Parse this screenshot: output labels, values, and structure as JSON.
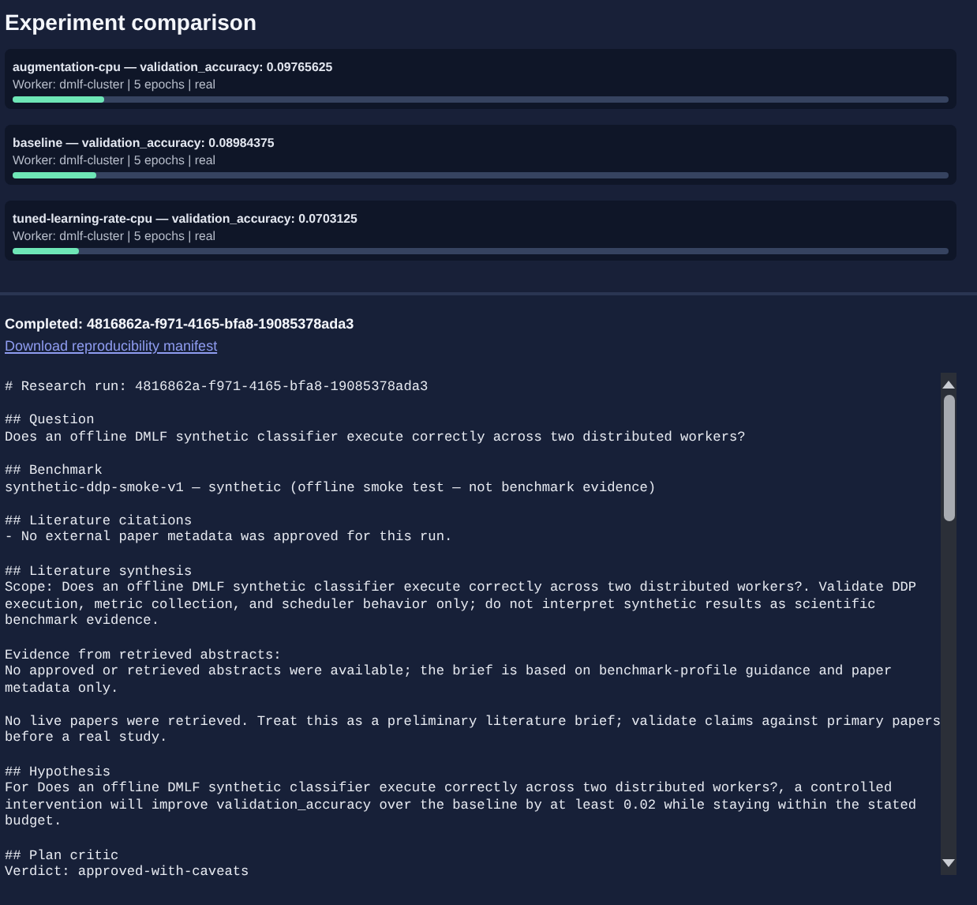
{
  "title": "Experiment comparison",
  "experiments": [
    {
      "heading": "augmentation-cpu — validation_accuracy: 0.09765625",
      "meta": "Worker: dmlf-cluster | 5 epochs | real",
      "level": 0.098
    },
    {
      "heading": "baseline — validation_accuracy: 0.08984375",
      "meta": "Worker: dmlf-cluster | 5 epochs | real",
      "level": 0.09
    },
    {
      "heading": "tuned-learning-rate-cpu — validation_accuracy: 0.0703125",
      "meta": "Worker: dmlf-cluster | 5 epochs | real",
      "level": 0.07
    }
  ],
  "run": {
    "status": "Completed: 4816862a-f971-4165-bfa8-19085378ada3",
    "link": "Download reproducibility manifest"
  },
  "report": [
    [
      "# Research run: 4816862a-f971-4165-bfa8-19085378ada3"
    ],
    [
      "## Question",
      "Does an offline DMLF synthetic classifier execute correctly across two distributed workers?"
    ],
    [
      "## Benchmark",
      "synthetic-ddp-smoke-v1 — synthetic (offline smoke test — not benchmark evidence)"
    ],
    [
      "## Literature citations",
      "- No external paper metadata was approved for this run."
    ],
    [
      "## Literature synthesis",
      "Scope: Does an offline DMLF synthetic classifier execute correctly across two distributed workers?. Validate DDP",
      "execution, metric collection, and scheduler behavior only; do not interpret synthetic results as scientific",
      "benchmark evidence."
    ],
    [
      "Evidence from retrieved abstracts:",
      "No approved or retrieved abstracts were available; the brief is based on benchmark-profile guidance and paper",
      "metadata only."
    ],
    [
      "No live papers were retrieved. Treat this as a preliminary literature brief; validate claims against primary papers",
      "before a real study."
    ],
    [
      "## Hypothesis",
      "For Does an offline DMLF synthetic classifier execute correctly across two distributed workers?, a controlled",
      "intervention will improve validation_accuracy over the baseline by at least 0.02 while staying within the stated",
      "budget."
    ],
    [
      "## Plan critic",
      "Verdict: approved-with-caveats"
    ]
  ]
}
